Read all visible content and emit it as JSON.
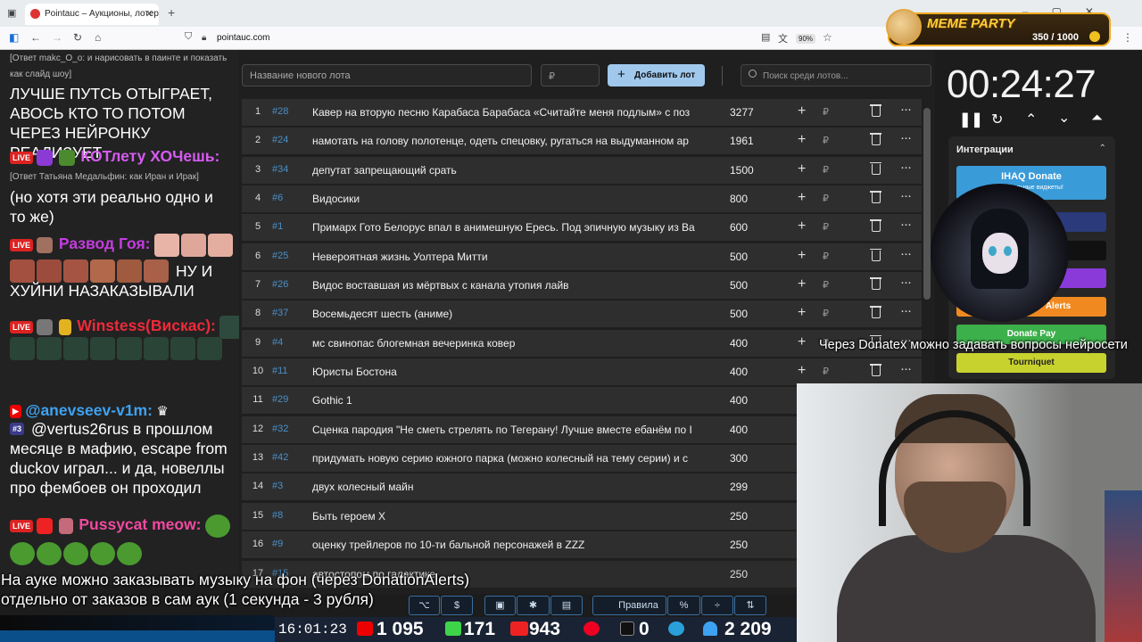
{
  "browser": {
    "tab_title": "Pointauc – Аукционы, лотереи",
    "url": "pointauc.com",
    "zoom": "90%"
  },
  "meme_party": {
    "title": "MEME PARTY",
    "progress": "350 / 1000"
  },
  "chat": {
    "reply1": "[Ответ makc_O_o: и нарисовать в паинте и показать как слайд шоу]",
    "msg1": "ЛУЧШЕ ПУТСЬ ОТЫГРАЕТ, АВОСЬ КТО ТО ПОТОМ ЧЕРЕЗ НЕЙРОНКУ РЕАЛИЗУЕТ",
    "user2": "КОТлету ХОЧешь:",
    "reply2": "[Ответ Татьяна Медальфин: как Иран и Ирак]",
    "msg2": "(но хотя эти реально одно и то же)",
    "user3": "Развод Гоя:",
    "msg3": "НУ И ХУЙНИ НАЗАКАЗЫВАЛИ",
    "user4": "Winstess(Вискас):",
    "user5": "@anevseev-v1m:",
    "rank6": "#3",
    "msg6": "@vertus26rus в прошлом месяце в мафию, escape from duckov играл... и да, новеллы про фембоев он проходил",
    "user7": "Pussycat meow:",
    "live": "LIVE"
  },
  "form": {
    "lot_placeholder": "Название нового лота",
    "price_placeholder": "₽",
    "add_label": "Добавить лот",
    "search_placeholder": "Поиск среди лотов..."
  },
  "lots": [
    {
      "idx": "1",
      "id": "#28",
      "name": "Кавер на вторую песню Карабаса Барабаса «Считайте меня подлым» с поз",
      "amount": "3277"
    },
    {
      "idx": "2",
      "id": "#24",
      "name": "намотать на голову полотенце, одеть спецовку, ругаться на выдуманном ар",
      "amount": "1961"
    },
    {
      "idx": "3",
      "id": "#34",
      "name": "депутат запрещающий срать",
      "amount": "1500"
    },
    {
      "idx": "4",
      "id": "#6",
      "name": "Видосики",
      "amount": "800"
    },
    {
      "idx": "5",
      "id": "#1",
      "name": "Примарх Гото Белорус впал в анимешную Ересь. Под эпичную музыку из Ва",
      "amount": "600"
    },
    {
      "idx": "6",
      "id": "#25",
      "name": "Невероятная жизнь Уолтера Митти",
      "amount": "500"
    },
    {
      "idx": "7",
      "id": "#26",
      "name": "Видос воставшая из мёртвых с канала утопия лайв",
      "amount": "500"
    },
    {
      "idx": "8",
      "id": "#37",
      "name": "Восемьдесят шесть (аниме)",
      "amount": "500"
    },
    {
      "idx": "9",
      "id": "#4",
      "name": "мс свинопас блогемная вечеринка ковер",
      "amount": "400"
    },
    {
      "idx": "10",
      "id": "#11",
      "name": "Юристы Бостона",
      "amount": "400"
    },
    {
      "idx": "11",
      "id": "#29",
      "name": "Gothic 1",
      "amount": "400"
    },
    {
      "idx": "12",
      "id": "#32",
      "name": "Сценка пародия \"Не сметь стрелять по Тегерану! Лучше вместе ебанём по I",
      "amount": "400"
    },
    {
      "idx": "13",
      "id": "#42",
      "name": "придумать новую серию южного парка (можно колесный на тему серии) и с",
      "amount": "300"
    },
    {
      "idx": "14",
      "id": "#3",
      "name": "двух колесный майн",
      "amount": "299"
    },
    {
      "idx": "15",
      "id": "#8",
      "name": "Быть героем X",
      "amount": "250"
    },
    {
      "idx": "16",
      "id": "#9",
      "name": "оценку трейлеров по 10-ти бальной персонажей в ZZZ",
      "amount": "250"
    },
    {
      "idx": "17",
      "id": "#15",
      "name": "автостопом по галактике",
      "amount": "250"
    }
  ],
  "toolbar": {
    "rules_label": "Правила",
    "currency_label": "$",
    "percent_label": "%"
  },
  "timer": "00:24:27",
  "integrations": {
    "header": "Интеграции",
    "ihaq": "IHAQ Donate",
    "ihaq_sub": "Уникальные виджеты!",
    "alerts": "Alerts",
    "donate_pay": "Donate Pay",
    "tourniquet": "Tourniquet",
    "ihaq_color": "#3a9bd9",
    "donatepay_color": "#3cb04a",
    "tourniquet_color": "#c8d22e"
  },
  "ticker": "Через Donatex можно задавать вопросы нейросети",
  "bottom_message": "На ауке можно заказывать музыку на фон (через DonationAlerts) отдельно от заказов в сам аук (1 секунда - 3 рубля)",
  "stats": {
    "clock": "16:01:23",
    "youtube": "1 095",
    "kick": "171",
    "vk": "943",
    "rumble": "0",
    "viewers": "2 209"
  }
}
